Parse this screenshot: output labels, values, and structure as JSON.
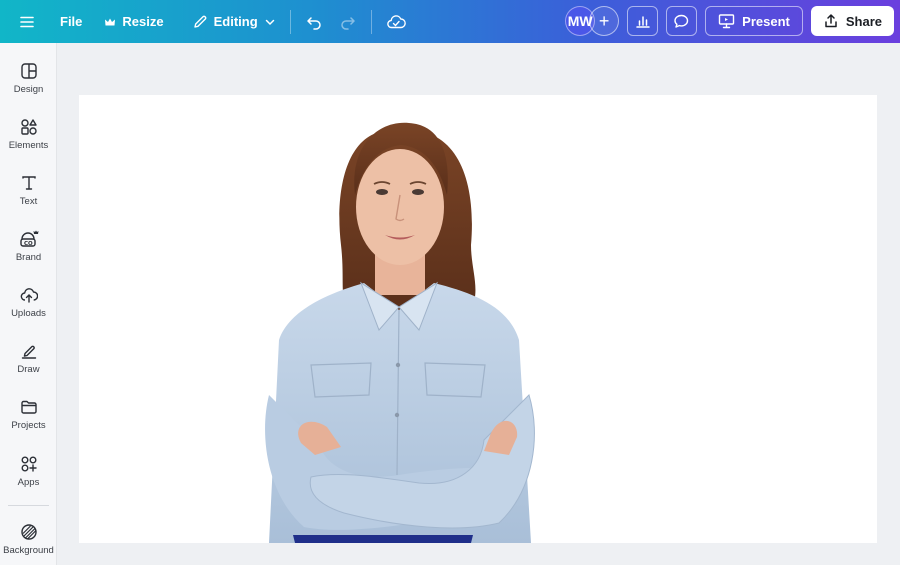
{
  "toolbar": {
    "file_label": "File",
    "resize_label": "Resize",
    "editing_label": "Editing",
    "avatar_initials": "MW",
    "add_label": "+",
    "present_label": "Present",
    "share_label": "Share"
  },
  "sidebar": {
    "items": [
      {
        "label": "Design",
        "icon": "layout-icon"
      },
      {
        "label": "Elements",
        "icon": "shapes-icon"
      },
      {
        "label": "Text",
        "icon": "text-icon"
      },
      {
        "label": "Brand",
        "icon": "brand-icon"
      },
      {
        "label": "Uploads",
        "icon": "cloud-upload-icon"
      },
      {
        "label": "Draw",
        "icon": "pen-icon"
      },
      {
        "label": "Projects",
        "icon": "folder-icon"
      },
      {
        "label": "Apps",
        "icon": "apps-icon"
      },
      {
        "label": "Background",
        "icon": "background-icon"
      }
    ]
  },
  "canvas": {
    "image_subject": "woman-arms-crossed-photo"
  },
  "colors": {
    "gradient_start": "#11b6c8",
    "gradient_end": "#6a3fde",
    "canvas_bg": "#eef0f3"
  }
}
